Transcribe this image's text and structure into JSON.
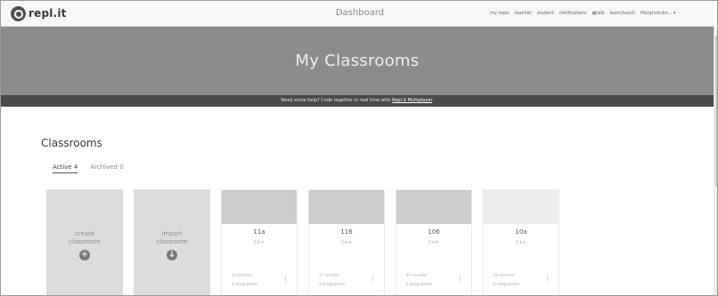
{
  "header": {
    "logo_text": "repl.it",
    "page_title": "Dashboard",
    "nav": [
      "my repls",
      "teacher",
      "student",
      "notifications",
      "talk",
      "learn/teach"
    ],
    "username": "Marghoitsko..."
  },
  "hero": {
    "title": "My Classrooms",
    "help_text": "Need some help? Code together in real time with ",
    "help_link": "Repl.it Multiplayer",
    "help_suffix": "."
  },
  "classrooms": {
    "section_title": "Classrooms",
    "tabs": [
      {
        "label": "Active 4",
        "active": true
      },
      {
        "label": "Archived 0",
        "active": false
      }
    ],
    "actions": [
      {
        "line1": "create",
        "line2": "classroom",
        "icon": "+"
      },
      {
        "line1": "import",
        "line2": "classroom",
        "icon": "↓"
      }
    ],
    "items": [
      {
        "name": "11a",
        "language": "C++",
        "enrolled": "14 enrolled",
        "assignments": "4 assignments"
      },
      {
        "name": "116",
        "language": "C++",
        "enrolled": "17 enrolled",
        "assignments": "3 assignments"
      },
      {
        "name": "106",
        "language": "C++",
        "enrolled": "25 enrolled",
        "assignments": "6 assignments"
      },
      {
        "name": "10a",
        "language": "C++",
        "enrolled": "24 enrolled",
        "assignments": "6 assignments"
      }
    ]
  }
}
